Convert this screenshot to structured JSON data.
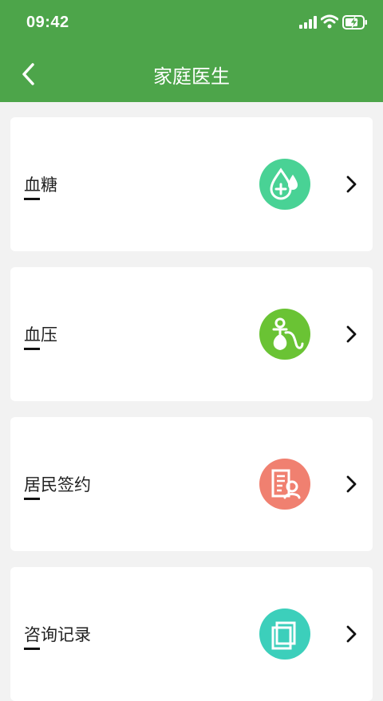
{
  "status_bar": {
    "time": "09:42"
  },
  "header": {
    "title": "家庭医生"
  },
  "menu": [
    {
      "label": "血糖",
      "icon": "blood-drop-plus-icon",
      "color": "#49d295"
    },
    {
      "label": "血压",
      "icon": "blood-pressure-cuff-icon",
      "color": "#6ac334"
    },
    {
      "label": "居民签约",
      "icon": "building-doctor-icon",
      "color": "#f08070"
    },
    {
      "label": "咨询记录",
      "icon": "records-icon",
      "color": "#3ccfbb"
    }
  ],
  "colors": {
    "header": "#4da54a",
    "background": "#f2f2f2"
  }
}
